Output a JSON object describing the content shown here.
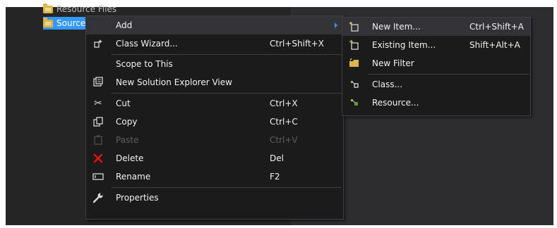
{
  "tree": {
    "top_label": "Resource Files",
    "selected_label": "Source Files"
  },
  "context_menu": {
    "items": [
      {
        "label": "Add",
        "shortcut": "",
        "icon": "none",
        "has_submenu": true
      },
      {
        "label": "Class Wizard...",
        "shortcut": "Ctrl+Shift+X",
        "icon": "class-wizard-icon"
      },
      {
        "label": "Scope to This",
        "shortcut": "",
        "icon": "none"
      },
      {
        "label": "New Solution Explorer View",
        "shortcut": "",
        "icon": "new-view-icon"
      },
      {
        "label": "Cut",
        "shortcut": "Ctrl+X",
        "icon": "scissors-icon"
      },
      {
        "label": "Copy",
        "shortcut": "Ctrl+C",
        "icon": "copy-icon"
      },
      {
        "label": "Paste",
        "shortcut": "Ctrl+V",
        "icon": "paste-icon",
        "disabled": true
      },
      {
        "label": "Delete",
        "shortcut": "Del",
        "icon": "delete-x-icon"
      },
      {
        "label": "Rename",
        "shortcut": "F2",
        "icon": "rename-icon"
      },
      {
        "label": "Properties",
        "shortcut": "",
        "icon": "wrench-icon"
      }
    ]
  },
  "add_submenu": {
    "items": [
      {
        "label": "New Item...",
        "shortcut": "Ctrl+Shift+A",
        "icon": "new-item-icon"
      },
      {
        "label": "Existing Item...",
        "shortcut": "Shift+Alt+A",
        "icon": "existing-item-icon"
      },
      {
        "label": "New Filter",
        "shortcut": "",
        "icon": "folder-icon"
      },
      {
        "label": "Class...",
        "shortcut": "",
        "icon": "class-icon"
      },
      {
        "label": "Resource...",
        "shortcut": "",
        "icon": "resource-icon"
      }
    ]
  },
  "colors": {
    "menu_bg": "#1b1b1c",
    "selection": "#3399ff",
    "delete_red": "#e51400",
    "accent_green": "#8dc63f"
  }
}
